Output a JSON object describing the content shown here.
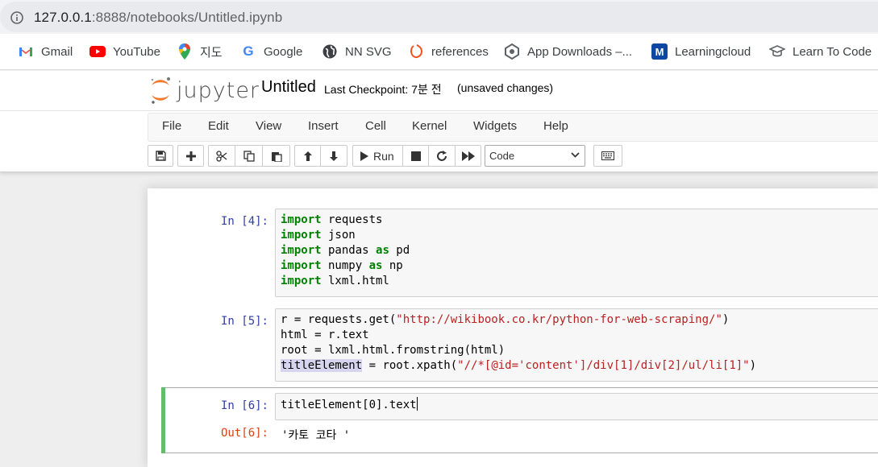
{
  "browser": {
    "url_host": "127.0.0.1",
    "url_path": ":8888/notebooks/Untitled.ipynb",
    "bookmarks": [
      {
        "label": "Gmail",
        "icon": "gmail-icon"
      },
      {
        "label": "YouTube",
        "icon": "youtube-icon"
      },
      {
        "label": "지도",
        "icon": "maps-pin-icon"
      },
      {
        "label": "Google",
        "icon": "google-g-icon"
      },
      {
        "label": "NN SVG",
        "icon": "globe-icon"
      },
      {
        "label": "references",
        "icon": "references-icon"
      },
      {
        "label": "App Downloads –...",
        "icon": "app-downloads-icon"
      },
      {
        "label": "Learningcloud",
        "icon": "learningcloud-icon"
      },
      {
        "label": "Learn To Code",
        "icon": "graduation-cap-icon"
      }
    ]
  },
  "jupyter": {
    "logo_text": "jupyter",
    "notebook_name": "Untitled",
    "checkpoint": "Last Checkpoint: 7분 전",
    "autosave_status": "(unsaved changes)",
    "menu": [
      "File",
      "Edit",
      "View",
      "Insert",
      "Cell",
      "Kernel",
      "Widgets",
      "Help"
    ],
    "toolbar": {
      "run_label": "Run",
      "cell_type": "Code"
    }
  },
  "cells": [
    {
      "prompt": "In [4]:",
      "lines": [
        "import requests",
        "import json",
        "import pandas as pd",
        "import numpy as np",
        "import lxml.html"
      ]
    },
    {
      "prompt": "In [5]:",
      "lines": [
        "r = requests.get(\"http://wikibook.co.kr/python-for-web-scraping/\")",
        "html = r.text",
        "root = lxml.html.fromstring(html)",
        "titleElement = root.xpath(\"//*[@id='content']/div[1]/div[2]/ul/li[1]\")"
      ]
    },
    {
      "prompt": "In [6]:",
      "lines": [
        "titleElement[0].text"
      ],
      "out_prompt": "Out[6]:",
      "output": "'카토 코타 '"
    }
  ],
  "colors": {
    "in_prompt": "#303f9f",
    "out_prompt": "#d84315",
    "keyword": "#008000",
    "string": "#ba2121",
    "selected_cell_bar": "#66bb6a"
  }
}
